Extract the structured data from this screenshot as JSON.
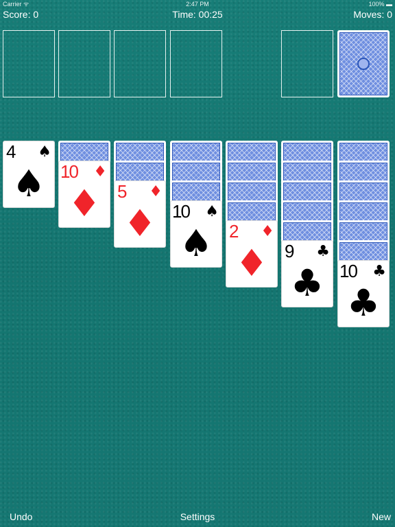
{
  "status_bar": {
    "carrier": "Carrier ᯤ",
    "clock": "2:47 PM",
    "battery": "100% ▬"
  },
  "hud": {
    "score": "Score: 0",
    "time": "Time: 00:25",
    "moves": "Moves: 0"
  },
  "foundations": [
    "",
    "",
    "",
    ""
  ],
  "stock": {
    "icon": "card-back"
  },
  "tableau": [
    {
      "hidden": 0,
      "faceup": [
        {
          "rank": "4",
          "suit": "♠",
          "color": "black"
        }
      ]
    },
    {
      "hidden": 1,
      "faceup": [
        {
          "rank": "10",
          "suit": "♦",
          "color": "red"
        }
      ]
    },
    {
      "hidden": 2,
      "faceup": [
        {
          "rank": "5",
          "suit": "♦",
          "color": "red"
        }
      ]
    },
    {
      "hidden": 3,
      "faceup": [
        {
          "rank": "10",
          "suit": "♠",
          "color": "black"
        }
      ]
    },
    {
      "hidden": 4,
      "faceup": [
        {
          "rank": "2",
          "suit": "♦",
          "color": "red"
        }
      ]
    },
    {
      "hidden": 5,
      "faceup": [
        {
          "rank": "9",
          "suit": "♣",
          "color": "black"
        }
      ]
    },
    {
      "hidden": 6,
      "faceup": [
        {
          "rank": "10",
          "suit": "♣",
          "color": "black"
        }
      ]
    }
  ],
  "toolbar": {
    "undo_label": "Undo",
    "settings_label": "Settings",
    "new_label": "New"
  },
  "colors": {
    "felt": "#167a74",
    "red_suit": "#f0242a",
    "card_back": "#6f8fe0"
  }
}
